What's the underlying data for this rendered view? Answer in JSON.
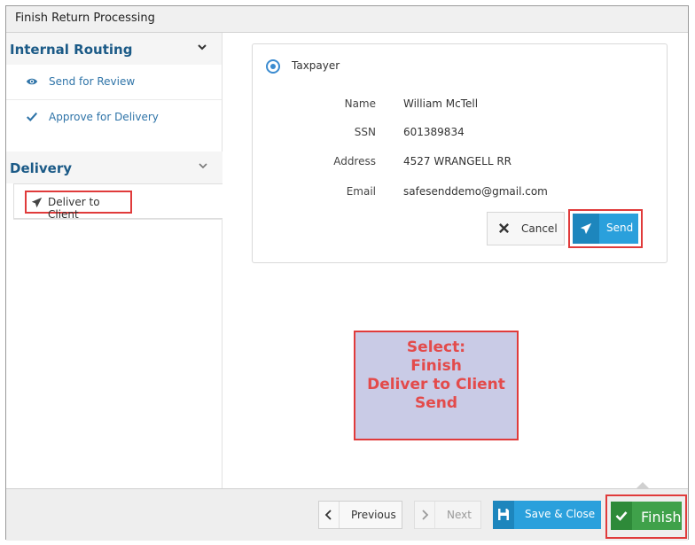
{
  "window": {
    "title": "Finish Return Processing"
  },
  "sidebar": {
    "sections": [
      {
        "title": "Internal Routing",
        "items": [
          {
            "label": "Send for Review",
            "icon": "eye-icon"
          },
          {
            "label": "Approve for Delivery",
            "icon": "checkmark-icon"
          }
        ]
      },
      {
        "title": "Delivery",
        "items": [
          {
            "label": "Deliver to Client",
            "icon": "paper-plane-icon"
          }
        ]
      }
    ]
  },
  "recipient": {
    "option_label": "Taxpayer",
    "fields": [
      {
        "label": "Name",
        "value": "William McTell"
      },
      {
        "label": "SSN",
        "value": "601389834"
      },
      {
        "label": "Address",
        "value": "4527 WRANGELL RR"
      },
      {
        "label": "Email",
        "value": "safesenddemo@gmail.com"
      }
    ],
    "cancel_label": "Cancel",
    "send_label": "Send"
  },
  "instruction": {
    "lines": [
      "Select:",
      "Finish",
      "Deliver to Client",
      "Send"
    ]
  },
  "footer": {
    "previous_label": "Previous",
    "next_label": "Next",
    "save_close_label": "Save & Close",
    "finish_label": "Finish"
  },
  "colors": {
    "accent_blue": "#2aa0dc",
    "finish_green": "#3fa14a",
    "highlight_red": "#e03b3b",
    "section_title": "#1b5a87"
  }
}
